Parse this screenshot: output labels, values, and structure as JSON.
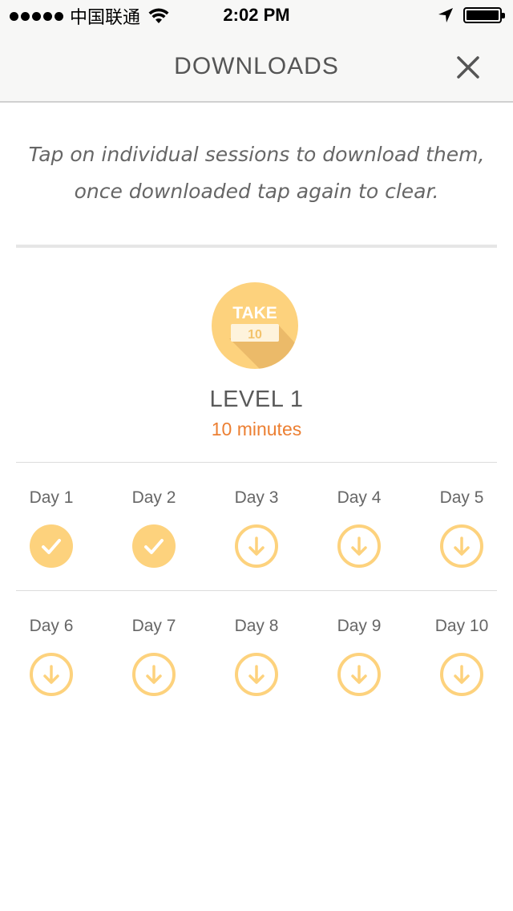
{
  "status_bar": {
    "carrier": "中国联通",
    "time": "2:02 PM"
  },
  "header": {
    "title": "DOWNLOADS",
    "close_icon": "close-icon"
  },
  "instructions": {
    "line1": "Tap on individual sessions to download them,",
    "line2": "once downloaded tap again to clear."
  },
  "level": {
    "badge_text_top": "TAKE",
    "badge_text_bottom": "10",
    "title": "LEVEL 1",
    "duration": "10 minutes"
  },
  "colors": {
    "accent_yellow": "#fdd27d",
    "accent_orange": "#ec7f32",
    "text_gray": "#5a5a5a"
  },
  "days": [
    {
      "label": "Day 1",
      "state": "downloaded",
      "icon": "check-icon"
    },
    {
      "label": "Day 2",
      "state": "downloaded",
      "icon": "check-icon"
    },
    {
      "label": "Day 3",
      "state": "not-downloaded",
      "icon": "download-icon"
    },
    {
      "label": "Day 4",
      "state": "not-downloaded",
      "icon": "download-icon"
    },
    {
      "label": "Day 5",
      "state": "not-downloaded",
      "icon": "download-icon"
    },
    {
      "label": "Day 6",
      "state": "not-downloaded",
      "icon": "download-icon"
    },
    {
      "label": "Day 7",
      "state": "not-downloaded",
      "icon": "download-icon"
    },
    {
      "label": "Day 8",
      "state": "not-downloaded",
      "icon": "download-icon"
    },
    {
      "label": "Day 9",
      "state": "not-downloaded",
      "icon": "download-icon"
    },
    {
      "label": "Day 10",
      "state": "not-downloaded",
      "icon": "download-icon"
    }
  ]
}
